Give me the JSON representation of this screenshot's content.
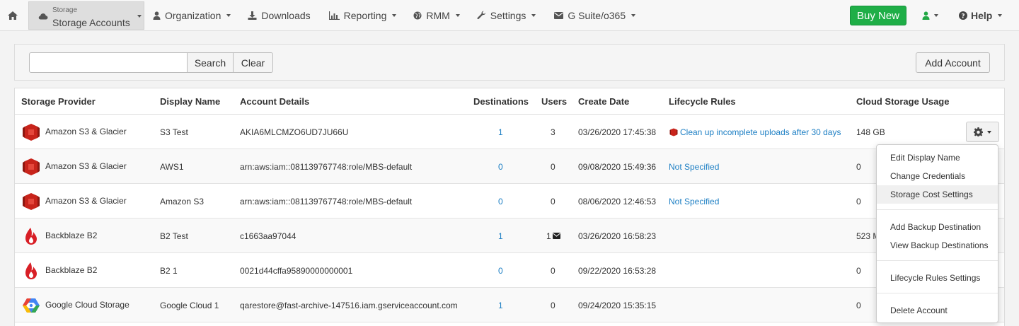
{
  "navbar": {
    "storage_small": "Storage",
    "storage_big": "Storage Accounts",
    "items": [
      {
        "label": "Organization",
        "icon": "user-icon"
      },
      {
        "label": "Downloads",
        "icon": "download-icon"
      },
      {
        "label": "Reporting",
        "icon": "bar-chart-icon"
      },
      {
        "label": "RMM",
        "icon": "globe-icon"
      },
      {
        "label": "Settings",
        "icon": "wrench-icon"
      },
      {
        "label": "G Suite/o365",
        "icon": "envelope-icon"
      }
    ],
    "buy_label": "Buy New",
    "help_label": "Help"
  },
  "search": {
    "placeholder": "",
    "value": "",
    "search_label": "Search",
    "clear_label": "Clear",
    "add_label": "Add Account"
  },
  "table": {
    "headers": [
      "Storage Provider",
      "Display Name",
      "Account Details",
      "Destinations",
      "Users",
      "Create Date",
      "Lifecycle Rules",
      "Cloud Storage Usage"
    ],
    "rows": [
      {
        "provider": "Amazon S3 & Glacier",
        "icon": "amazon-s3-icon",
        "display": "S3 Test",
        "details": "AKIA6MLCMZO6UD7JU66U",
        "destinations": "1",
        "users": "3",
        "date": "03/26/2020 17:45:38",
        "lifecycle": "Clean up incomplete uploads after 30 days",
        "usage": "148 GB"
      },
      {
        "provider": "Amazon S3 & Glacier",
        "icon": "amazon-s3-icon",
        "display": "AWS1",
        "details": "arn:aws:iam::081139767748:role/MBS-default",
        "destinations": "0",
        "users": "0",
        "date": "09/08/2020 15:49:36",
        "lifecycle": "Not Specified",
        "usage": "0"
      },
      {
        "provider": "Amazon S3 & Glacier",
        "icon": "amazon-s3-icon",
        "display": "Amazon S3",
        "details": "arn:aws:iam::081139767748:role/MBS-default",
        "destinations": "0",
        "users": "0",
        "date": "08/06/2020 12:46:53",
        "lifecycle": "Not Specified",
        "usage": "0"
      },
      {
        "provider": "Backblaze B2",
        "icon": "backblaze-icon",
        "display": "B2 Test",
        "details": "c1663aa97044",
        "destinations": "1",
        "users": "1",
        "date": "03/26/2020 16:58:23",
        "lifecycle": "",
        "usage": "523 M"
      },
      {
        "provider": "Backblaze B2",
        "icon": "backblaze-icon",
        "display": "B2 1",
        "details": "0021d44cffa95890000000001",
        "destinations": "0",
        "users": "0",
        "date": "09/22/2020 16:53:28",
        "lifecycle": "",
        "usage": "0"
      },
      {
        "provider": "Google Cloud Storage",
        "icon": "google-cloud-icon",
        "display": "Google Cloud 1",
        "details": "qarestore@fast-archive-147516.iam.gserviceaccount.com",
        "destinations": "1",
        "users": "0",
        "date": "09/24/2020 15:35:15",
        "lifecycle": "",
        "usage": "0"
      }
    ]
  },
  "dropdown": {
    "items": [
      "Edit Display Name",
      "Change Credentials",
      "Storage Cost Settings",
      "Add Backup Destination",
      "View Backup Destinations",
      "Lifecycle Rules Settings",
      "Delete Account"
    ]
  },
  "colors": {
    "link": "#1d7fc4",
    "buy_green": "#1fae47",
    "user_green": "#22a745",
    "amazon_red": "#d0271d"
  }
}
